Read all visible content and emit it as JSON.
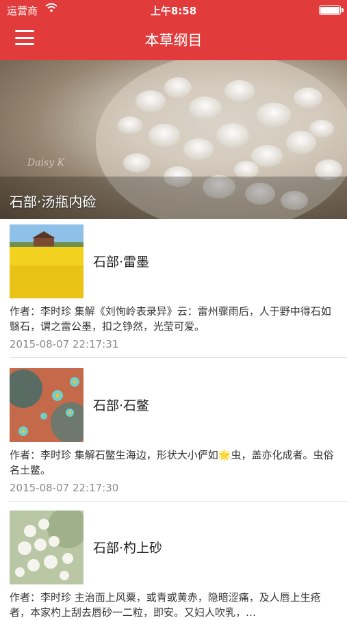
{
  "status_bar": {
    "carrier": "运营商",
    "time": "上午8:58"
  },
  "header": {
    "title": "本草纲目"
  },
  "banner": {
    "caption": "石部·汤瓶内硷",
    "watermark": "Daisy K"
  },
  "articles": [
    {
      "title": "石部·雷墨",
      "body": "作者：李时珍 集解《刘恂岭表录异》云：雷州骤雨后，人于野中得石如翳石，谓之雷公墨，扣之铮然，光莹可爱。",
      "date": "2015-08-07 22:17:31",
      "thumb": "canola-field-barn"
    },
    {
      "title": "石部·石鳖",
      "body": "作者：李时珍 集解石鳖生海边，形状大小俨如🌟虫，盖亦化成者。虫俗名土鳖。",
      "date": "2015-08-07 22:17:30",
      "thumb": "teal-blossoms"
    },
    {
      "title": "石部·杓上砂",
      "body": "作者：李时珍 主治面上风粟，或青或黄赤，隐暗涩痛，及人唇上生疮者，本家杓上刮去唇砂一二粒，即安。又妇人吹乳，…",
      "date": "",
      "thumb": "white-blossoms"
    }
  ],
  "colors": {
    "header": "#e13b3b",
    "date_text": "#8a8a8a",
    "separator": "#e3e3e3"
  }
}
